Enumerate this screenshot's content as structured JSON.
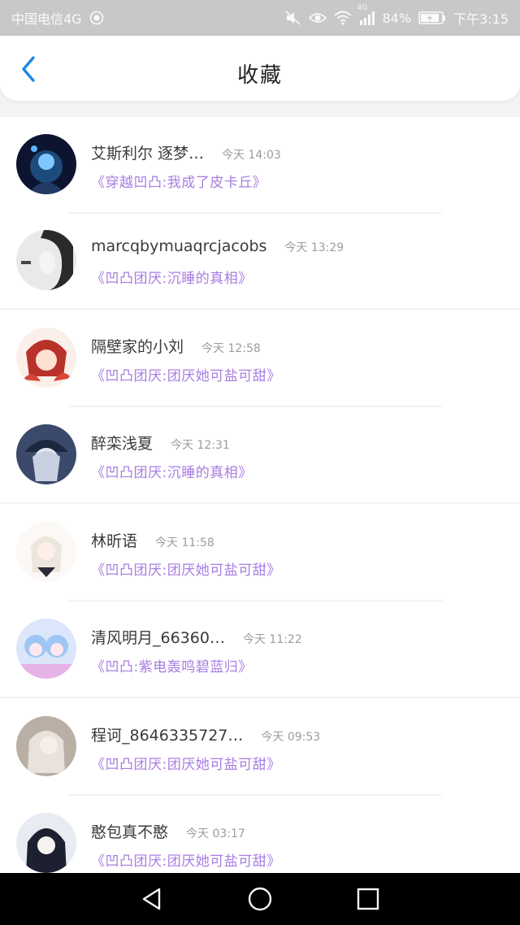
{
  "status_bar": {
    "carrier": "中国电信4G",
    "network_badge": "4G",
    "battery": "84%",
    "time": "下午3:15",
    "icons": [
      "sync-icon",
      "mute-icon",
      "eye-icon",
      "wifi-icon",
      "signal-icon",
      "battery-icon"
    ]
  },
  "header": {
    "back_icon": "chevron-left-icon",
    "title": "收藏",
    "accent_color": "#1e88e5"
  },
  "colors": {
    "status_bar_bg": "#c8c8c8",
    "link_purple": "#a77de2",
    "name_text": "#3a3a3a",
    "time_text": "#9c9c9c"
  },
  "favorites": [
    {
      "name": "艾斯利尔 逐梦…",
      "time": "今天 14:03",
      "title": "《穿越凹凸:我成了皮卡丘》"
    },
    {
      "name": "marcqbymuaqrcjacobs",
      "time": "今天 13:29",
      "title": "《凹凸团厌:沉睡的真相》"
    },
    {
      "name": "隔壁家的小刘",
      "time": "今天 12:58",
      "title": "《凹凸团厌:团厌她可盐可甜》"
    },
    {
      "name": "醉栾浅夏",
      "time": "今天 12:31",
      "title": "《凹凸团厌:沉睡的真相》"
    },
    {
      "name": "林昕语",
      "time": "今天 11:58",
      "title": "《凹凸团厌:团厌她可盐可甜》"
    },
    {
      "name": "清风明月_66360…",
      "time": "今天 11:22",
      "title": "《凹凸:紫电轰鸣碧蓝归》"
    },
    {
      "name": "程诃_8646335727…",
      "time": "今天 09:53",
      "title": "《凹凸团厌:团厌她可盐可甜》"
    },
    {
      "name": "憨包真不憨",
      "time": "今天 03:17",
      "title": "《凹凸团厌:团厌她可盐可甜》"
    }
  ],
  "nav": {
    "back_icon": "triangle-back-icon",
    "home_icon": "circle-home-icon",
    "recents_icon": "square-recents-icon"
  }
}
